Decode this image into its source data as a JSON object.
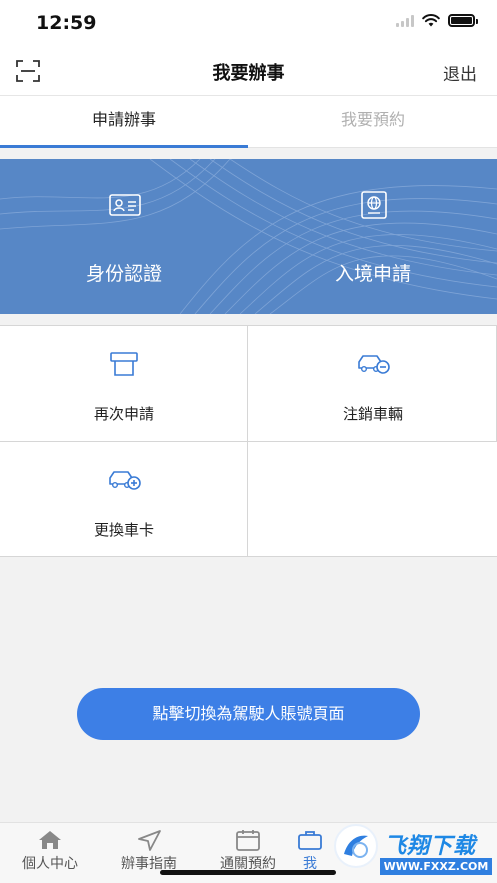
{
  "status_bar": {
    "time": "12:59"
  },
  "nav": {
    "title": "我要辦事",
    "logout_label": "退出"
  },
  "tabs": [
    {
      "label": "申請辦事",
      "active": true
    },
    {
      "label": "我要預約",
      "active": false
    }
  ],
  "banner": {
    "items": [
      {
        "label": "身份認證",
        "icon": "id-card-icon"
      },
      {
        "label": "入境申請",
        "icon": "passport-icon"
      }
    ],
    "color": "#5787c6"
  },
  "grid": {
    "items": [
      {
        "label": "再次申請",
        "icon": "printer-icon"
      },
      {
        "label": "注銷車輛",
        "icon": "car-remove-icon"
      },
      {
        "label": "更換車卡",
        "icon": "car-add-icon"
      }
    ]
  },
  "switch_button": {
    "label": "點擊切換為駕駛人賬號頁面",
    "color": "#3d7fe6"
  },
  "bottom_tabs": [
    {
      "label": "個人中心",
      "icon": "home-icon",
      "active": false
    },
    {
      "label": "辦事指南",
      "icon": "navigation-icon",
      "active": false
    },
    {
      "label": "通關預約",
      "icon": "calendar-icon",
      "active": false
    },
    {
      "label": "我",
      "icon": "briefcase-icon",
      "active": true
    }
  ],
  "watermark": {
    "title": "飞翔下载",
    "url": "WWW.FXXZ.COM"
  },
  "accent_color": "#3a7bd5"
}
